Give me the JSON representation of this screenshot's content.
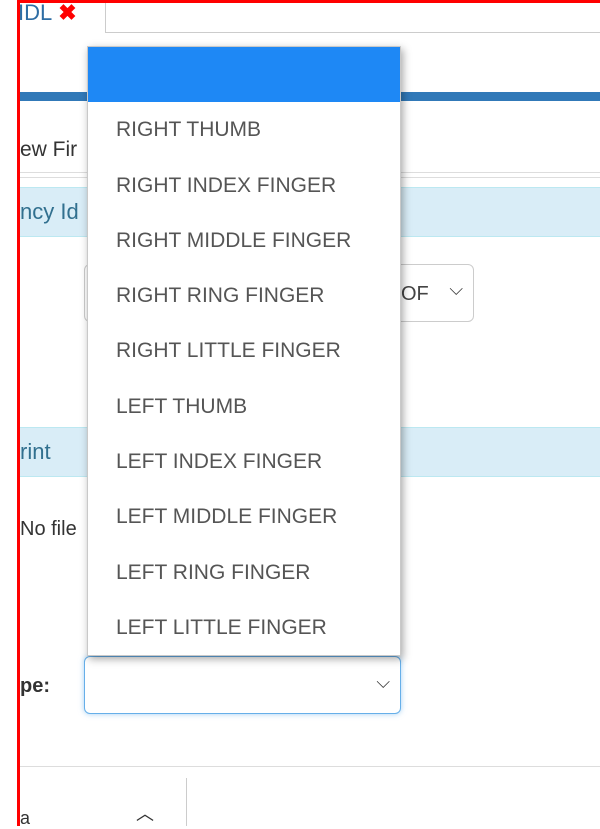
{
  "tab": {
    "label": "IDL",
    "close_icon": "close-x-icon"
  },
  "page": {
    "new_fin_text": "ew Fir",
    "section1_title": "ncy Id",
    "section2_title": "rint",
    "hidden_select_text": "OF",
    "no_file_text": "No file",
    "type_label": "pe:",
    "bottom_label": "a"
  },
  "dropdown": {
    "selected_value": "",
    "options": [
      "",
      "RIGHT THUMB",
      "RIGHT INDEX FINGER",
      "RIGHT MIDDLE FINGER",
      "RIGHT RING FINGER",
      "RIGHT LITTLE FINGER",
      "LEFT THUMB",
      "LEFT INDEX FINGER",
      "LEFT MIDDLE FINGER",
      "LEFT RING FINGER",
      "LEFT LITTLE FINGER"
    ]
  },
  "colors": {
    "highlight": "#1e88f5",
    "header_bar": "#3179b8",
    "section_bg": "#d9edf7",
    "section_text": "#31708f",
    "annotation_red": "#ff0000"
  }
}
